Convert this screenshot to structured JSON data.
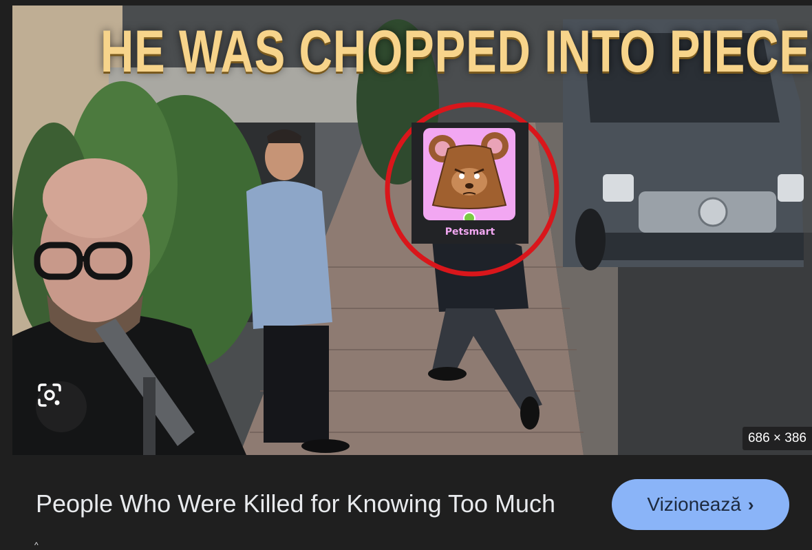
{
  "thumbnail": {
    "headline": "HE WAS CHOPPED INTO PIECES",
    "dimensions_label": "686 × 386",
    "lens_icon": "visual-search-icon",
    "badge_label": "Petsmart"
  },
  "result": {
    "title": "People Who Were Killed for Knowing Too Much",
    "watch_label": "Vizionează",
    "watch_icon": "chevron-right-icon"
  },
  "colors": {
    "page_bg": "#1f1f1f",
    "button_bg": "#8ab4f8",
    "headline": "#f7d48b",
    "badge_pink": "#f2a7f2",
    "circle_red": "#d9161b"
  }
}
